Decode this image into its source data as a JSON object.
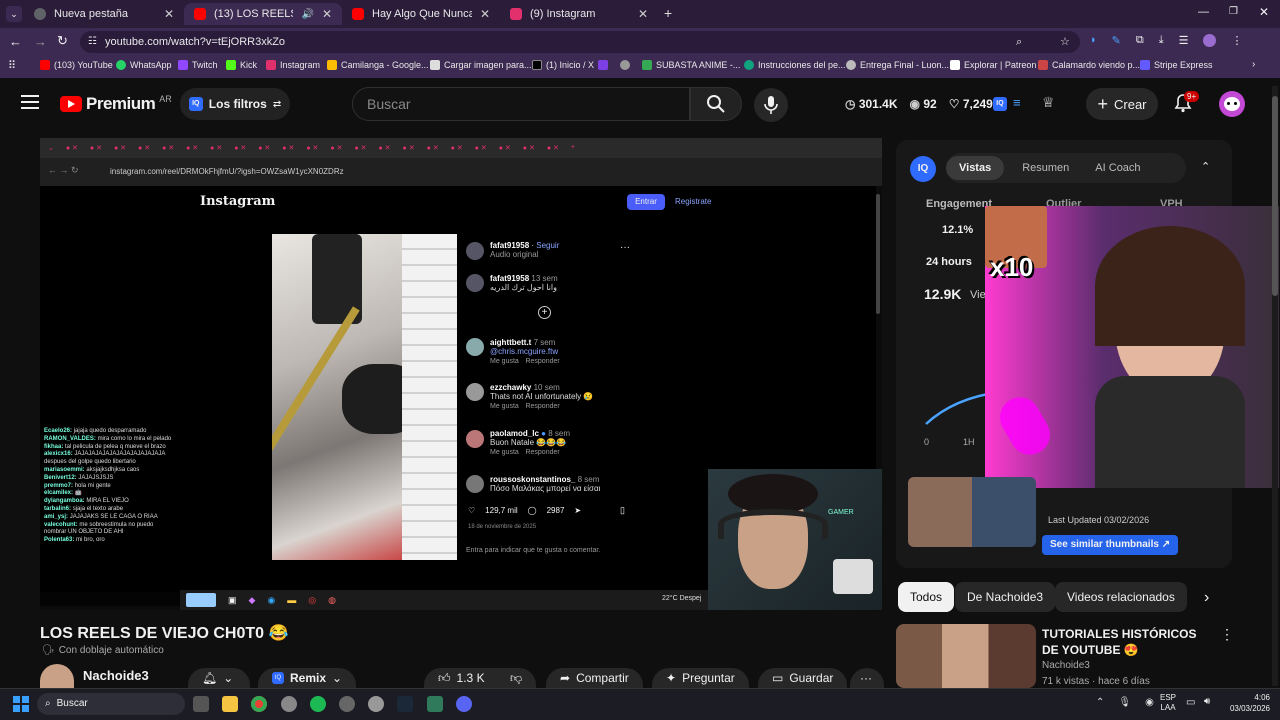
{
  "browser": {
    "tabs": [
      {
        "title": "Nueva pestaña",
        "color": "#5f6368"
      },
      {
        "title": "(13) LOS REELS DE VIEJO CH",
        "color": "#ff0000"
      },
      {
        "title": "Hay Algo Que Nunca Les Dije -",
        "color": "#ff0000"
      },
      {
        "title": "(9) Instagram",
        "color": "#e1306c"
      }
    ],
    "url": "youtube.com/watch?v=tEjORR3xkZo",
    "bookmarks": [
      "(103) YouTube",
      "WhatsApp",
      "Twitch",
      "Kick",
      "Instagram",
      "Camilanga - Google...",
      "Cargar imagen para...",
      "(1) Inicio / X",
      "",
      "",
      "SUBASTA ANIME -...",
      "Instrucciones del pe...",
      "Entrega Final - Luon...",
      "Explorar | Patreon",
      "Calamardo viendo p...",
      "Stripe Express"
    ]
  },
  "youtube": {
    "logo": "Premium",
    "region": "AR",
    "filters_label": "Los filtros",
    "search_placeholder": "Buscar",
    "stats": {
      "views": "301.4K",
      "subs": "92",
      "other": "7,249"
    },
    "create_label": "Crear",
    "notif_count": "9+"
  },
  "video": {
    "title": "LOS REELS DE VIEJO CH0T0 😂",
    "dub_label": "Con doblaje automático",
    "channel": "Nachoide3",
    "actions": {
      "remix": "Remix",
      "likes": "1.3 K",
      "share": "Compartir",
      "ask": "Preguntar",
      "save": "Guardar"
    },
    "instagram": {
      "url": "instagram.com/reel/DRMOkFhjfmU/?igsh=OWZsaW1ycXN0ZDRz",
      "brand": "Instagram",
      "login": "Entrar",
      "register": "Registrate",
      "poster": "fafat91958",
      "follow": "Seguir",
      "audio": "Audio original",
      "caption_user": "fafat91958",
      "caption_time": "13 sem",
      "caption_text": "وانا احول ترك الدريه",
      "comments": [
        {
          "user": "aighttbett.t",
          "time": "7 sem",
          "text": "@chris.mcguire.ftw"
        },
        {
          "user": "ezzchawky",
          "time": "10 sem",
          "text": "Thats not AI unfortunately 😢"
        },
        {
          "user": "paolamod_lc",
          "time": "8 sem",
          "text": "Buon Natale 😂😂😂"
        },
        {
          "user": "roussoskonstantinos_",
          "time": "8 sem",
          "text": "Πόσο Μαλάκας μπορεί να είσαι"
        }
      ],
      "reply": "Responder",
      "like": "Me gusta",
      "likes_count": "129,7 mil",
      "comments_count": "2987",
      "date": "18 de noviembre de 2025",
      "login_prompt": "Entra para indicar que te gusta o comentar.",
      "login_link": "Entra"
    },
    "chat": [
      {
        "user": "Ecaelo26:",
        "msg": "jajaja quedo desparramado"
      },
      {
        "user": "RAMON_VALDES:",
        "msg": "mira como lo mira el pelado"
      },
      {
        "user": "fikhaa:",
        "msg": "tal pelicula de pelea q mueve el brazo"
      },
      {
        "user": "alexicx16:",
        "msg": "JAJAJAJAJAJAJAJAJAJAJAJAJA despues del golpe quedo libertario"
      },
      {
        "user": "mariasoemmi:",
        "msg": "aksjajksdhjksa caos"
      },
      {
        "user": "Benivert12:",
        "msg": "JAJAJSJSJS"
      },
      {
        "user": "premmo7:",
        "msg": "hola mi gente"
      },
      {
        "user": "elcamilex:",
        "msg": "🤖"
      },
      {
        "user": "dylangamboa:",
        "msg": "MIRA EL VIEJO"
      },
      {
        "user": "tarbalin6:",
        "msg": "sjaja el texto arabe"
      },
      {
        "user": "ami_ysj:",
        "msg": "JAJAJAKS SE LE CAGA O RIAA"
      },
      {
        "user": "valecohunt:",
        "msg": "me sobreestimula no puedo nombrar UN OBJETO DE AHI"
      },
      {
        "user": "Polenta63:",
        "msg": "mi bro, oro"
      }
    ],
    "weather": "22°C  Despej",
    "x10": "x10"
  },
  "panel": {
    "tabs": [
      "Vistas",
      "Resumen",
      "AI Coach"
    ],
    "metrics": [
      "Engagement",
      "Outlier",
      "VPH"
    ],
    "engagement": "12.1%",
    "period": "24 hours",
    "views_value": "12.9K",
    "views_label": "Views",
    "axis": [
      "0",
      "1H"
    ],
    "last_updated": "Last Updated 03/02/2026",
    "similar": "See similar thumbnails ↗"
  },
  "recs": {
    "chips": [
      "Todos",
      "De Nachoide3",
      "Videos relacionados"
    ],
    "items": [
      {
        "title": "TUTORIALES HISTÓRICOS DE YOUTUBE 😍",
        "channel": "Nachoide3",
        "meta": "71 k vistas · hace 6 días"
      }
    ]
  },
  "taskbar": {
    "search": "Buscar",
    "lang1": "ESP",
    "lang2": "LAA",
    "time": "4:06",
    "date": "03/03/2026"
  }
}
